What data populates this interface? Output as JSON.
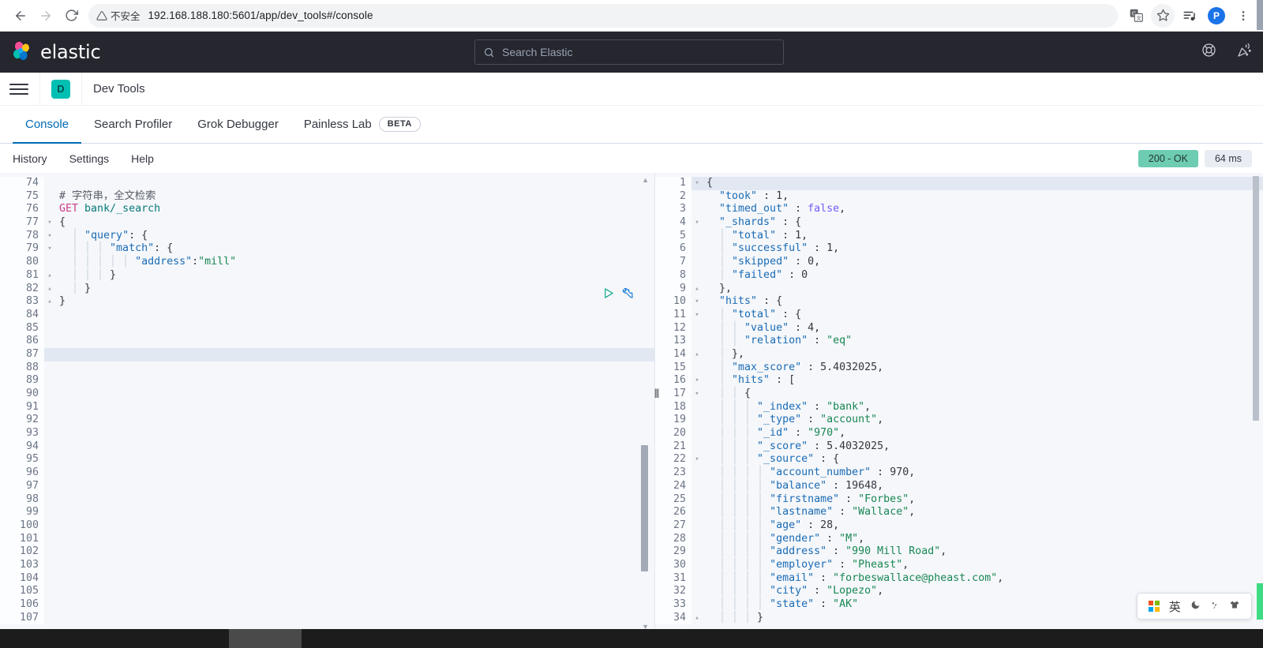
{
  "browser": {
    "back_icon": "arrow-left-icon",
    "forward_icon": "arrow-right-icon",
    "reload_icon": "reload-icon",
    "security_label": "不安全",
    "url": "192.168.188.180:5601/app/dev_tools#/console",
    "translate_icon": "translate-icon",
    "bookmark_icon": "star-icon",
    "media_icon": "media-playlist-icon",
    "profile_initial": "P",
    "menu_icon": "three-dot-menu-icon"
  },
  "elastic_header": {
    "logo_text": "elastic",
    "search_placeholder": "Search Elastic",
    "search_icon": "search-icon",
    "help_icon": "help-ring-icon",
    "news_icon": "party-popper-icon"
  },
  "app_header": {
    "menu_icon": "hamburger-menu-icon",
    "app_badge": "D",
    "title": "Dev Tools"
  },
  "tabs": [
    {
      "label": "Console",
      "active": true,
      "badge": null
    },
    {
      "label": "Search Profiler",
      "active": false,
      "badge": null
    },
    {
      "label": "Grok Debugger",
      "active": false,
      "badge": null
    },
    {
      "label": "Painless Lab",
      "active": false,
      "badge": "BETA"
    }
  ],
  "console_toolbar": {
    "links": [
      "History",
      "Settings",
      "Help"
    ],
    "status_code": "200 - OK",
    "status_color": "#6dccb1",
    "duration": "64 ms"
  },
  "editor": {
    "play_icon": "play-request-icon",
    "wrench_icon": "wrench-icon",
    "highlighted_line": 87,
    "lines": [
      {
        "n": 74,
        "fold": "",
        "tokens": []
      },
      {
        "n": 75,
        "fold": "",
        "tokens": [
          {
            "c": "t-cmt",
            "s": "# 字符串，全文检索"
          }
        ]
      },
      {
        "n": 76,
        "fold": "",
        "tokens": [
          {
            "c": "t-kw",
            "s": "GET"
          },
          {
            "c": "t-pun",
            "s": " "
          },
          {
            "c": "t-url",
            "s": "bank/_search"
          }
        ]
      },
      {
        "n": 77,
        "fold": "▾",
        "tokens": [
          {
            "c": "t-pun",
            "s": "{"
          }
        ]
      },
      {
        "n": 78,
        "fold": "▾",
        "tokens": [
          {
            "c": "t-guide",
            "s": "  │ "
          },
          {
            "c": "t-key",
            "s": "\"query\""
          },
          {
            "c": "t-pun",
            "s": ": {"
          }
        ]
      },
      {
        "n": 79,
        "fold": "▾",
        "tokens": [
          {
            "c": "t-guide",
            "s": "  │ │ │ "
          },
          {
            "c": "t-key",
            "s": "\"match\""
          },
          {
            "c": "t-pun",
            "s": ": {"
          }
        ]
      },
      {
        "n": 80,
        "fold": "",
        "tokens": [
          {
            "c": "t-guide",
            "s": "  │ │ │ │ │ "
          },
          {
            "c": "t-key",
            "s": "\"address\""
          },
          {
            "c": "t-pun",
            "s": ":"
          },
          {
            "c": "t-str",
            "s": "\"mill\""
          }
        ]
      },
      {
        "n": 81,
        "fold": "▴",
        "tokens": [
          {
            "c": "t-guide",
            "s": "  │ │ │ "
          },
          {
            "c": "t-pun",
            "s": "}"
          }
        ]
      },
      {
        "n": 82,
        "fold": "▴",
        "tokens": [
          {
            "c": "t-guide",
            "s": "  │ "
          },
          {
            "c": "t-pun",
            "s": "}"
          }
        ]
      },
      {
        "n": 83,
        "fold": "▴",
        "tokens": [
          {
            "c": "t-pun",
            "s": "}"
          }
        ]
      },
      {
        "n": 84,
        "fold": "",
        "tokens": []
      },
      {
        "n": 85,
        "fold": "",
        "tokens": []
      },
      {
        "n": 86,
        "fold": "",
        "tokens": []
      },
      {
        "n": 87,
        "fold": "",
        "tokens": []
      },
      {
        "n": 88,
        "fold": "",
        "tokens": []
      },
      {
        "n": 89,
        "fold": "",
        "tokens": []
      },
      {
        "n": 90,
        "fold": "",
        "tokens": []
      },
      {
        "n": 91,
        "fold": "",
        "tokens": []
      },
      {
        "n": 92,
        "fold": "",
        "tokens": []
      },
      {
        "n": 93,
        "fold": "",
        "tokens": []
      },
      {
        "n": 94,
        "fold": "",
        "tokens": []
      },
      {
        "n": 95,
        "fold": "",
        "tokens": []
      },
      {
        "n": 96,
        "fold": "",
        "tokens": []
      },
      {
        "n": 97,
        "fold": "",
        "tokens": []
      },
      {
        "n": 98,
        "fold": "",
        "tokens": []
      },
      {
        "n": 99,
        "fold": "",
        "tokens": []
      },
      {
        "n": 100,
        "fold": "",
        "tokens": []
      },
      {
        "n": 101,
        "fold": "",
        "tokens": []
      },
      {
        "n": 102,
        "fold": "",
        "tokens": []
      },
      {
        "n": 103,
        "fold": "",
        "tokens": []
      },
      {
        "n": 104,
        "fold": "",
        "tokens": []
      },
      {
        "n": 105,
        "fold": "",
        "tokens": []
      },
      {
        "n": 106,
        "fold": "",
        "tokens": []
      },
      {
        "n": 107,
        "fold": "",
        "tokens": []
      }
    ]
  },
  "response": {
    "highlighted_line": 1,
    "lines": [
      {
        "n": 1,
        "fold": "▾",
        "tokens": [
          {
            "c": "t-pun",
            "s": "{"
          }
        ]
      },
      {
        "n": 2,
        "fold": "",
        "tokens": [
          {
            "c": "t-guide",
            "s": "  "
          },
          {
            "c": "t-key",
            "s": "\"took\""
          },
          {
            "c": "t-pun",
            "s": " : "
          },
          {
            "c": "t-num",
            "s": "1,"
          }
        ]
      },
      {
        "n": 3,
        "fold": "",
        "tokens": [
          {
            "c": "t-guide",
            "s": "  "
          },
          {
            "c": "t-key",
            "s": "\"timed_out\""
          },
          {
            "c": "t-pun",
            "s": " : "
          },
          {
            "c": "t-bool",
            "s": "false"
          },
          {
            "c": "t-pun",
            "s": ","
          }
        ]
      },
      {
        "n": 4,
        "fold": "▾",
        "tokens": [
          {
            "c": "t-guide",
            "s": "  "
          },
          {
            "c": "t-key",
            "s": "\"_shards\""
          },
          {
            "c": "t-pun",
            "s": " : {"
          }
        ]
      },
      {
        "n": 5,
        "fold": "",
        "tokens": [
          {
            "c": "t-guide",
            "s": "  │ "
          },
          {
            "c": "t-key",
            "s": "\"total\""
          },
          {
            "c": "t-pun",
            "s": " : "
          },
          {
            "c": "t-num",
            "s": "1,"
          }
        ]
      },
      {
        "n": 6,
        "fold": "",
        "tokens": [
          {
            "c": "t-guide",
            "s": "  │ "
          },
          {
            "c": "t-key",
            "s": "\"successful\""
          },
          {
            "c": "t-pun",
            "s": " : "
          },
          {
            "c": "t-num",
            "s": "1,"
          }
        ]
      },
      {
        "n": 7,
        "fold": "",
        "tokens": [
          {
            "c": "t-guide",
            "s": "  │ "
          },
          {
            "c": "t-key",
            "s": "\"skipped\""
          },
          {
            "c": "t-pun",
            "s": " : "
          },
          {
            "c": "t-num",
            "s": "0,"
          }
        ]
      },
      {
        "n": 8,
        "fold": "",
        "tokens": [
          {
            "c": "t-guide",
            "s": "  │ "
          },
          {
            "c": "t-key",
            "s": "\"failed\""
          },
          {
            "c": "t-pun",
            "s": " : "
          },
          {
            "c": "t-num",
            "s": "0"
          }
        ]
      },
      {
        "n": 9,
        "fold": "▴",
        "tokens": [
          {
            "c": "t-guide",
            "s": "  "
          },
          {
            "c": "t-pun",
            "s": "},"
          }
        ]
      },
      {
        "n": 10,
        "fold": "▾",
        "tokens": [
          {
            "c": "t-guide",
            "s": "  "
          },
          {
            "c": "t-key",
            "s": "\"hits\""
          },
          {
            "c": "t-pun",
            "s": " : {"
          }
        ]
      },
      {
        "n": 11,
        "fold": "▾",
        "tokens": [
          {
            "c": "t-guide",
            "s": "  │ "
          },
          {
            "c": "t-key",
            "s": "\"total\""
          },
          {
            "c": "t-pun",
            "s": " : {"
          }
        ]
      },
      {
        "n": 12,
        "fold": "",
        "tokens": [
          {
            "c": "t-guide",
            "s": "  │ │ "
          },
          {
            "c": "t-key",
            "s": "\"value\""
          },
          {
            "c": "t-pun",
            "s": " : "
          },
          {
            "c": "t-num",
            "s": "4,"
          }
        ]
      },
      {
        "n": 13,
        "fold": "",
        "tokens": [
          {
            "c": "t-guide",
            "s": "  │ │ "
          },
          {
            "c": "t-key",
            "s": "\"relation\""
          },
          {
            "c": "t-pun",
            "s": " : "
          },
          {
            "c": "t-str",
            "s": "\"eq\""
          }
        ]
      },
      {
        "n": 14,
        "fold": "▴",
        "tokens": [
          {
            "c": "t-guide",
            "s": "  │ "
          },
          {
            "c": "t-pun",
            "s": "},"
          }
        ]
      },
      {
        "n": 15,
        "fold": "",
        "tokens": [
          {
            "c": "t-guide",
            "s": "  │ "
          },
          {
            "c": "t-key",
            "s": "\"max_score\""
          },
          {
            "c": "t-pun",
            "s": " : "
          },
          {
            "c": "t-num",
            "s": "5.4032025,"
          }
        ]
      },
      {
        "n": 16,
        "fold": "▾",
        "tokens": [
          {
            "c": "t-guide",
            "s": "  │ "
          },
          {
            "c": "t-key",
            "s": "\"hits\""
          },
          {
            "c": "t-pun",
            "s": " : ["
          }
        ]
      },
      {
        "n": 17,
        "fold": "▾",
        "tokens": [
          {
            "c": "t-guide",
            "s": "  │ │ "
          },
          {
            "c": "t-pun",
            "s": "{"
          }
        ]
      },
      {
        "n": 18,
        "fold": "",
        "tokens": [
          {
            "c": "t-guide",
            "s": "  │ │ │ "
          },
          {
            "c": "t-key",
            "s": "\"_index\""
          },
          {
            "c": "t-pun",
            "s": " : "
          },
          {
            "c": "t-str",
            "s": "\"bank\""
          },
          {
            "c": "t-pun",
            "s": ","
          }
        ]
      },
      {
        "n": 19,
        "fold": "",
        "tokens": [
          {
            "c": "t-guide",
            "s": "  │ │ │ "
          },
          {
            "c": "t-key",
            "s": "\"_type\""
          },
          {
            "c": "t-pun",
            "s": " : "
          },
          {
            "c": "t-str",
            "s": "\"account\""
          },
          {
            "c": "t-pun",
            "s": ","
          }
        ]
      },
      {
        "n": 20,
        "fold": "",
        "tokens": [
          {
            "c": "t-guide",
            "s": "  │ │ │ "
          },
          {
            "c": "t-key",
            "s": "\"_id\""
          },
          {
            "c": "t-pun",
            "s": " : "
          },
          {
            "c": "t-str",
            "s": "\"970\""
          },
          {
            "c": "t-pun",
            "s": ","
          }
        ]
      },
      {
        "n": 21,
        "fold": "",
        "tokens": [
          {
            "c": "t-guide",
            "s": "  │ │ │ "
          },
          {
            "c": "t-key",
            "s": "\"_score\""
          },
          {
            "c": "t-pun",
            "s": " : "
          },
          {
            "c": "t-num",
            "s": "5.4032025,"
          }
        ]
      },
      {
        "n": 22,
        "fold": "▾",
        "tokens": [
          {
            "c": "t-guide",
            "s": "  │ │ │ "
          },
          {
            "c": "t-key",
            "s": "\"_source\""
          },
          {
            "c": "t-pun",
            "s": " : {"
          }
        ]
      },
      {
        "n": 23,
        "fold": "",
        "tokens": [
          {
            "c": "t-guide",
            "s": "  │ │ │ │ "
          },
          {
            "c": "t-key",
            "s": "\"account_number\""
          },
          {
            "c": "t-pun",
            "s": " : "
          },
          {
            "c": "t-num",
            "s": "970,"
          }
        ]
      },
      {
        "n": 24,
        "fold": "",
        "tokens": [
          {
            "c": "t-guide",
            "s": "  │ │ │ │ "
          },
          {
            "c": "t-key",
            "s": "\"balance\""
          },
          {
            "c": "t-pun",
            "s": " : "
          },
          {
            "c": "t-num",
            "s": "19648,"
          }
        ]
      },
      {
        "n": 25,
        "fold": "",
        "tokens": [
          {
            "c": "t-guide",
            "s": "  │ │ │ │ "
          },
          {
            "c": "t-key",
            "s": "\"firstname\""
          },
          {
            "c": "t-pun",
            "s": " : "
          },
          {
            "c": "t-str",
            "s": "\"Forbes\""
          },
          {
            "c": "t-pun",
            "s": ","
          }
        ]
      },
      {
        "n": 26,
        "fold": "",
        "tokens": [
          {
            "c": "t-guide",
            "s": "  │ │ │ │ "
          },
          {
            "c": "t-key",
            "s": "\"lastname\""
          },
          {
            "c": "t-pun",
            "s": " : "
          },
          {
            "c": "t-str",
            "s": "\"Wallace\""
          },
          {
            "c": "t-pun",
            "s": ","
          }
        ]
      },
      {
        "n": 27,
        "fold": "",
        "tokens": [
          {
            "c": "t-guide",
            "s": "  │ │ │ │ "
          },
          {
            "c": "t-key",
            "s": "\"age\""
          },
          {
            "c": "t-pun",
            "s": " : "
          },
          {
            "c": "t-num",
            "s": "28,"
          }
        ]
      },
      {
        "n": 28,
        "fold": "",
        "tokens": [
          {
            "c": "t-guide",
            "s": "  │ │ │ │ "
          },
          {
            "c": "t-key",
            "s": "\"gender\""
          },
          {
            "c": "t-pun",
            "s": " : "
          },
          {
            "c": "t-str",
            "s": "\"M\""
          },
          {
            "c": "t-pun",
            "s": ","
          }
        ]
      },
      {
        "n": 29,
        "fold": "",
        "tokens": [
          {
            "c": "t-guide",
            "s": "  │ │ │ │ "
          },
          {
            "c": "t-key",
            "s": "\"address\""
          },
          {
            "c": "t-pun",
            "s": " : "
          },
          {
            "c": "t-str",
            "s": "\"990 Mill Road\""
          },
          {
            "c": "t-pun",
            "s": ","
          }
        ]
      },
      {
        "n": 30,
        "fold": "",
        "tokens": [
          {
            "c": "t-guide",
            "s": "  │ │ │ │ "
          },
          {
            "c": "t-key",
            "s": "\"employer\""
          },
          {
            "c": "t-pun",
            "s": " : "
          },
          {
            "c": "t-str",
            "s": "\"Pheast\""
          },
          {
            "c": "t-pun",
            "s": ","
          }
        ]
      },
      {
        "n": 31,
        "fold": "",
        "tokens": [
          {
            "c": "t-guide",
            "s": "  │ │ │ │ "
          },
          {
            "c": "t-key",
            "s": "\"email\""
          },
          {
            "c": "t-pun",
            "s": " : "
          },
          {
            "c": "t-str",
            "s": "\"forbeswallace@pheast.com\""
          },
          {
            "c": "t-pun",
            "s": ","
          }
        ]
      },
      {
        "n": 32,
        "fold": "",
        "tokens": [
          {
            "c": "t-guide",
            "s": "  │ │ │ │ "
          },
          {
            "c": "t-key",
            "s": "\"city\""
          },
          {
            "c": "t-pun",
            "s": " : "
          },
          {
            "c": "t-str",
            "s": "\"Lopezo\""
          },
          {
            "c": "t-pun",
            "s": ","
          }
        ]
      },
      {
        "n": 33,
        "fold": "",
        "tokens": [
          {
            "c": "t-guide",
            "s": "  │ │ │ │ "
          },
          {
            "c": "t-key",
            "s": "\"state\""
          },
          {
            "c": "t-pun",
            "s": " : "
          },
          {
            "c": "t-str",
            "s": "\"AK\""
          }
        ]
      },
      {
        "n": 34,
        "fold": "▴",
        "tokens": [
          {
            "c": "t-guide",
            "s": "  │ │ │ "
          },
          {
            "c": "t-pun",
            "s": "}"
          }
        ]
      }
    ]
  },
  "ime": {
    "logo_icon": "ime-logo-icon",
    "mode": "英",
    "moon_icon": "moon-icon",
    "punct_icon": "punctuation-icon",
    "skin_icon": "skin-shirt-icon"
  }
}
